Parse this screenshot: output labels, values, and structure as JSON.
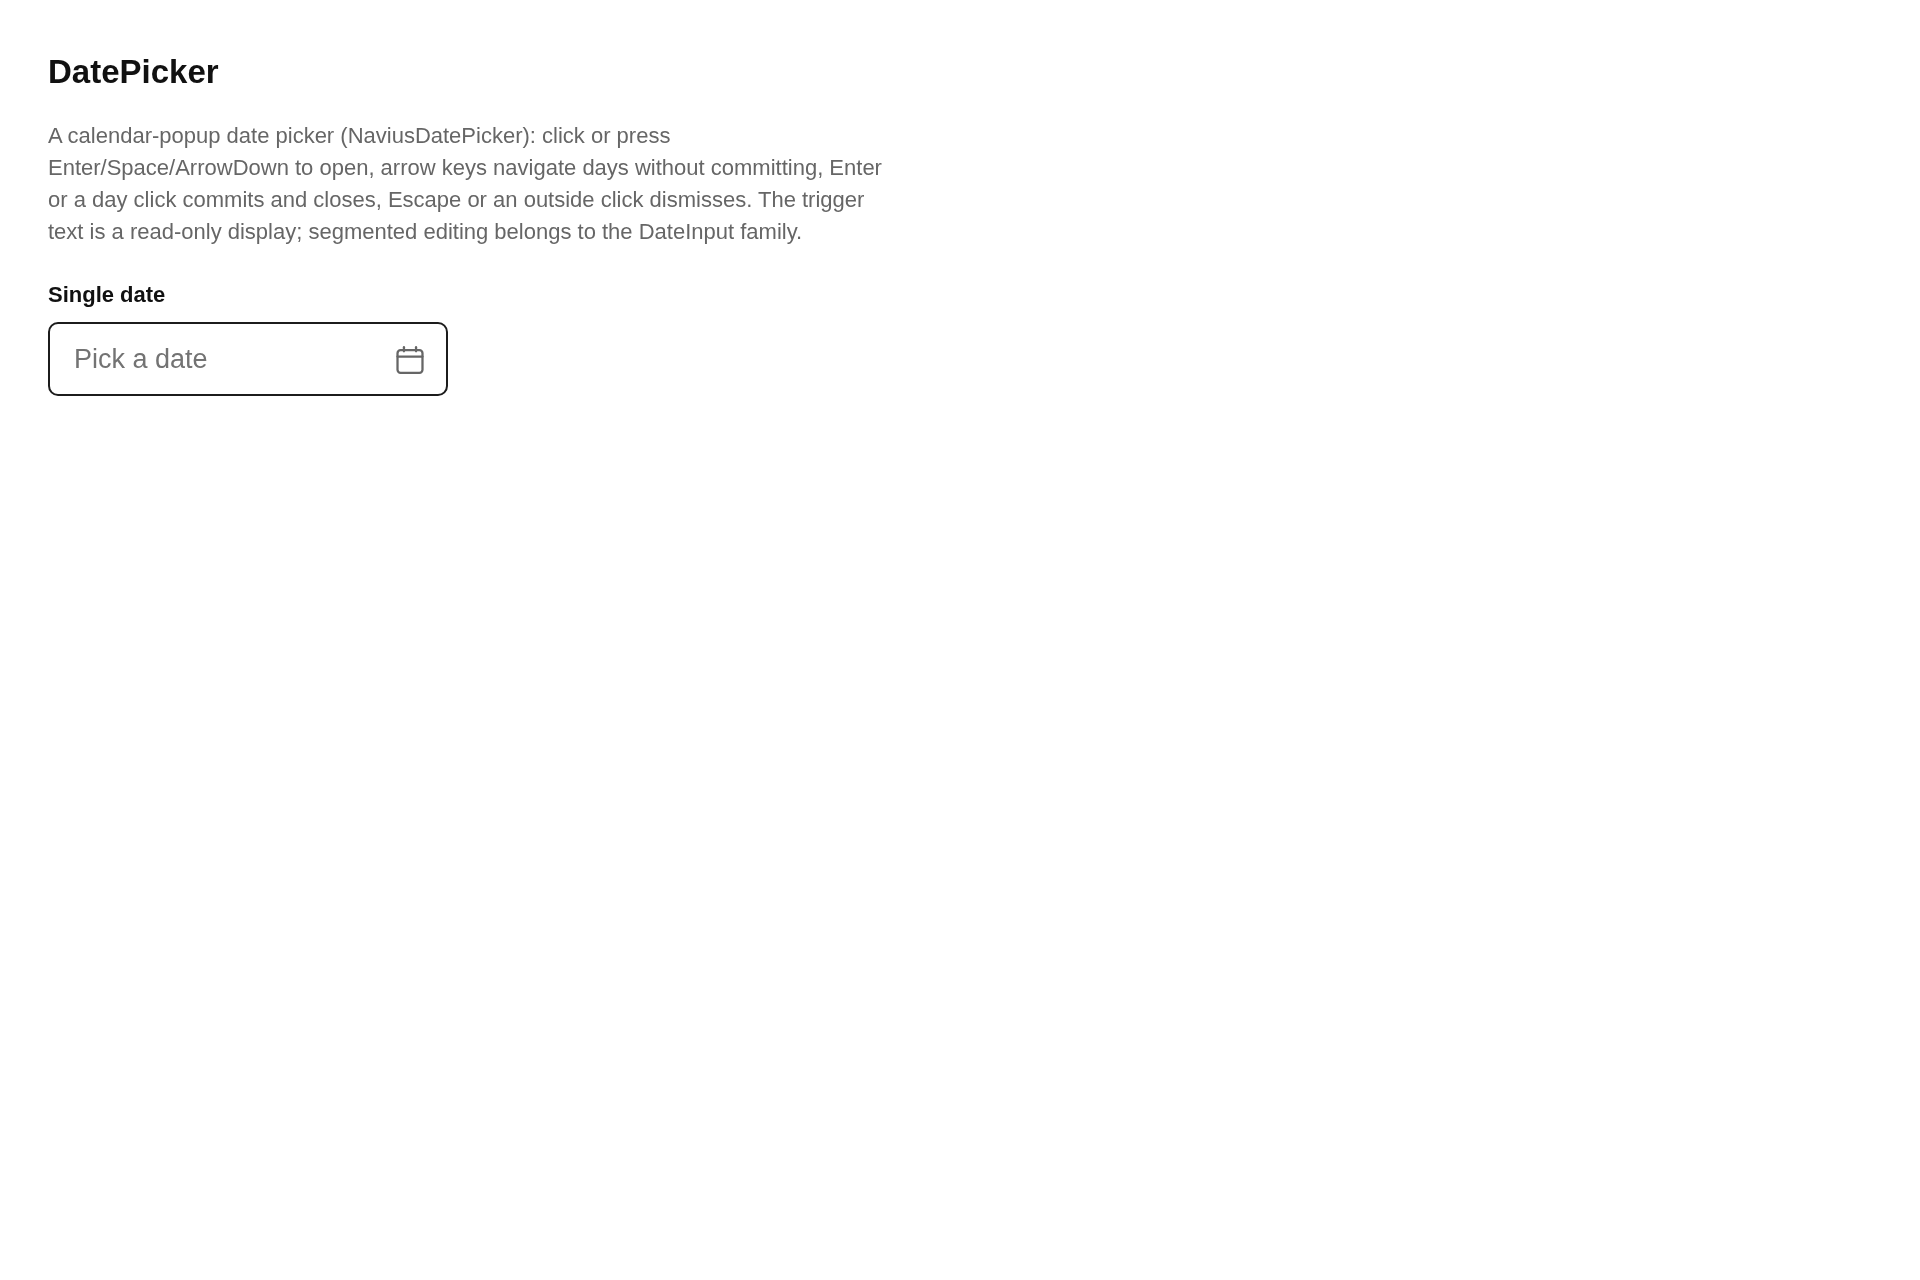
{
  "page": {
    "title": "DatePicker",
    "description": "A calendar-popup date picker (NaviusDatePicker): click or press Enter/Space/ArrowDown to open, arrow keys navigate days without committing, Enter or a day click commits and closes, Escape or an outside click dismisses. The trigger text is a read-only display; segmented editing belongs to the DateInput family."
  },
  "field": {
    "label": "Single date",
    "placeholder": "Pick a date"
  }
}
